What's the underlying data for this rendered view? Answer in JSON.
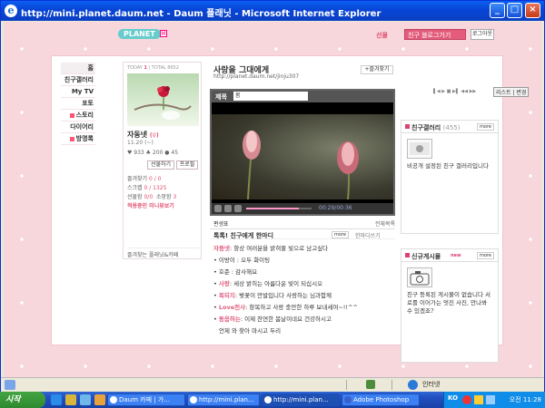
{
  "window": {
    "title": "http://mini.planet.daum.net - Daum 플래닛 - Microsoft Internet Explorer",
    "minimize": "_",
    "maximize": "□",
    "close": "×"
  },
  "topbar": {
    "logo": "PLANET",
    "m_mark": "M",
    "link": "선물",
    "select_value": "친구 블로그가기",
    "logout": "로그아웃"
  },
  "menu": {
    "items": [
      {
        "label": "홈"
      },
      {
        "label": "친구갤러리"
      },
      {
        "label": "My TV"
      },
      {
        "label": "포토"
      },
      {
        "label": "스토리"
      },
      {
        "label": "다이어리"
      },
      {
        "label": "방명록"
      }
    ]
  },
  "profile": {
    "today_label": "TODAY",
    "today": "1",
    "total_label": "TOTAL",
    "total": "8652",
    "name": "자동넷",
    "gender": "(♀)",
    "birth": "11.20 (~)",
    "hearts": "933",
    "leaves": "200",
    "drops": "45",
    "stats_line": "♥ 933   ♣ 200   ● 45",
    "gift_button": "선물하기",
    "profile_button": "프로필",
    "fav_label": "즐겨찾기",
    "fav_value": "0 / 0",
    "scrap_label": "스크랩",
    "scrap_value": "0 / 1325",
    "gift_label": "선물함",
    "gift_value": "0/0",
    "album_label": "소망함",
    "album_value": "3",
    "active_label": "적용중인 미니뷰보기",
    "footer": "즐겨찾는 플래닛&카페"
  },
  "blog": {
    "title": "사랑을 그대에게",
    "url": "http://planet.daum.net/jinju307",
    "fav_button": "+즐겨찾기"
  },
  "player": {
    "label": "제목",
    "select_value": "봄",
    "time": "00:29/00:36",
    "progress": 0.8
  },
  "post": {
    "edit": "편생표",
    "all_list": "전체목록",
    "title": "톡톡! 친구에게 한마디",
    "more": "more",
    "write": "한마디쓰기",
    "lines": [
      {
        "key": "자동넷",
        "text": ": 항상 여러분을 밝혀줄 빛으로 남고싶다"
      },
      {
        "key": "",
        "text": "• 이방이 : 오두 화이팅"
      },
      {
        "key": "",
        "text": "• 호준 : 감사해요"
      },
      {
        "key": "사랑",
        "text": ": 세상 밝히는 아름다운 빛이 되십시오"
      },
      {
        "key": "복되지",
        "text": ": 벚꽃이 만발입니다 사랑하는 님과함께"
      },
      {
        "key": "Love천사",
        "text": ": 항복하고 사랑 충만한 하루 보내세여~!!^^"
      },
      {
        "key": "동음하는",
        "text": ": 이제 찬연한 봄날이네요 건강하시고"
      },
      {
        "key": "",
        "text": "언제 와 찾아 마시고 두리"
      }
    ]
  },
  "right": {
    "list_label": "리스트",
    "list_button": "변경",
    "gallery_title": "친구갤러리",
    "gallery_count": "(455)",
    "gallery_more": "more",
    "gallery_text": "비공개 설정된 친구 갤러리입니다",
    "new_title": "신규게시물",
    "new_badge": "new",
    "new_more": "more",
    "new_text": "친구 등록된 게시물이 없습니다 서로를 이어가는 멋진 사진, 만나봐 수 있겠죠?"
  },
  "statusbar": {
    "zone": "인터넷"
  },
  "taskbar": {
    "start": "시작",
    "tasks": [
      {
        "label": "Daum 카페 | 가..."
      },
      {
        "label": "http://mini.plan..."
      },
      {
        "label": "http://mini.plan..."
      },
      {
        "label": "Adobe Photoshop"
      }
    ],
    "ime": "KO",
    "clock": "오전 11:28"
  }
}
